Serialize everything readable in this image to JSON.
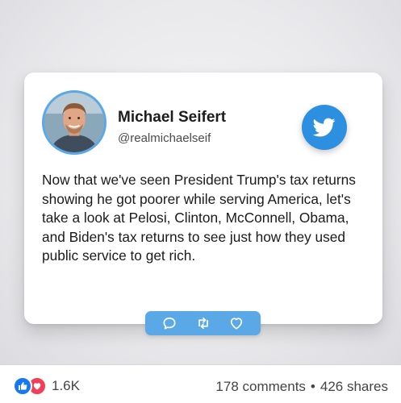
{
  "tweet": {
    "name": "Michael Seifert",
    "handle": "@realmichaelseif",
    "text": "Now that we've seen President Trump's tax returns showing he got poorer while serving America, let's take a look at Pelosi, Clinton, McConnell, Obama, and Biden's tax returns to see just how they used public service to get rich.",
    "brand_icon": "twitter-bird-icon",
    "actions": [
      "reply-icon",
      "retweet-icon",
      "like-heart-icon"
    ]
  },
  "footer": {
    "reaction_icons": [
      "like-icon",
      "love-icon"
    ],
    "reaction_count": "1.6K",
    "comments": "178 comments",
    "separator": "•",
    "shares": "426 shares"
  },
  "colors": {
    "twitter_blue": "#2d8fe0",
    "action_bar": "#5aa9e6",
    "like_blue": "#1877f2",
    "love_red": "#f33e58"
  }
}
